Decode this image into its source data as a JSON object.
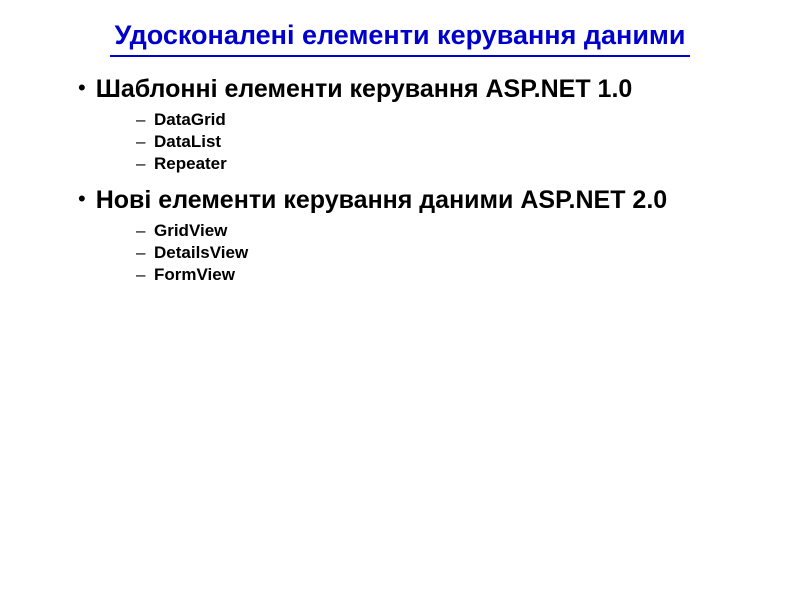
{
  "title": "Удосконалені елементи керування даними",
  "sections": [
    {
      "heading": "Шаблонні елементи керування ASP.NET 1.0",
      "items": [
        "DataGrid",
        "DataList",
        "Repeater"
      ]
    },
    {
      "heading": "Нові елементи керування даними ASP.NET 2.0",
      "items": [
        "GridView",
        "DetailsView",
        "FormView"
      ]
    }
  ]
}
